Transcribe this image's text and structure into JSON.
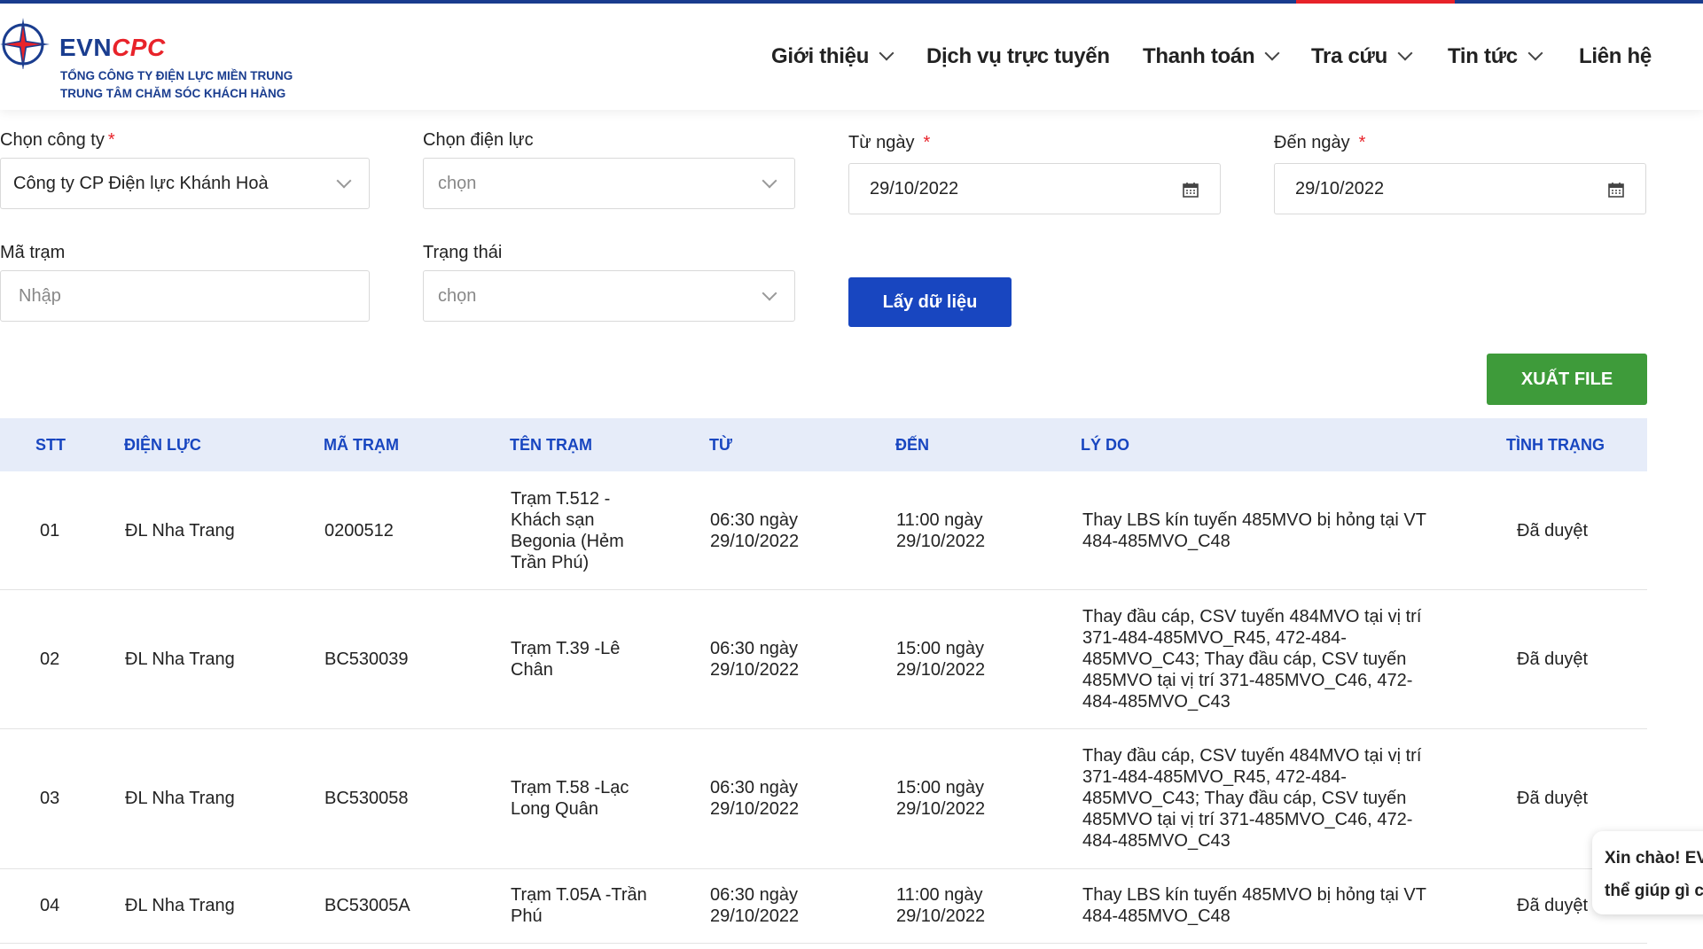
{
  "header": {
    "brand_evn": "EVN",
    "brand_cpc": "CPC",
    "subtitle_1": "TỔNG CÔNG TY ĐIỆN LỰC MIỀN TRUNG",
    "subtitle_2": "TRUNG TÂM CHĂM SÓC KHÁCH HÀNG",
    "nav": [
      {
        "label": "Giới thiệu"
      },
      {
        "label": "Dịch vụ trực tuyến"
      },
      {
        "label": "Thanh toán"
      },
      {
        "label": "Tra cứu"
      },
      {
        "label": "Tin tức"
      },
      {
        "label": "Liên hệ"
      }
    ]
  },
  "form": {
    "company_label": "Chọn công ty",
    "company_value": "Công ty CP Điện lực Khánh Hoà",
    "district_label": "Chọn điện lực",
    "district_placeholder": "chọn",
    "from_label": "Từ ngày",
    "from_value": "29/10/2022",
    "to_label": "Đến ngày",
    "to_value": "29/10/2022",
    "station_label": "Mã trạm",
    "station_placeholder": "Nhập",
    "status_label": "Trạng thái",
    "status_placeholder": "chọn",
    "required_mark": "*",
    "get_button": "Lấy dữ liệu",
    "export_button": "XUẤT FILE"
  },
  "table": {
    "headers": [
      "STT",
      "ĐIỆN LỰC",
      "MÃ TRẠM",
      "TÊN TRẠM",
      "TỪ",
      "ĐẾN",
      "LÝ DO",
      "TÌNH TRẠNG"
    ],
    "rows": [
      {
        "stt": "01",
        "dienluc": "ĐL Nha Trang",
        "matram": "0200512",
        "tentram": "Trạm T.512 - Khách sạn Begonia (Hẻm Trần Phú)",
        "tu": "06:30 ngày 29/10/2022",
        "den": "11:00 ngày 29/10/2022",
        "lydo": "Thay LBS kín tuyến 485MVO bị hỏng tại VT 484-485MVO_C48",
        "tinhtrang": "Đã duyệt"
      },
      {
        "stt": "02",
        "dienluc": "ĐL Nha Trang",
        "matram": "BC530039",
        "tentram": "Trạm T.39 -Lê Chân",
        "tu": "06:30 ngày 29/10/2022",
        "den": "15:00 ngày 29/10/2022",
        "lydo": "Thay đầu cáp, CSV tuyến 484MVO tại vị trí 371-484-485MVO_R45, 472-484-485MVO_C43; Thay đầu cáp, CSV tuyến 485MVO tại vị trí 371-485MVO_C46, 472-484-485MVO_C43",
        "tinhtrang": "Đã duyệt"
      },
      {
        "stt": "03",
        "dienluc": "ĐL Nha Trang",
        "matram": "BC530058",
        "tentram": "Trạm T.58 -Lạc Long Quân",
        "tu": "06:30 ngày 29/10/2022",
        "den": "15:00 ngày 29/10/2022",
        "lydo": "Thay đầu cáp, CSV tuyến 484MVO tại vị trí 371-484-485MVO_R45, 472-484-485MVO_C43; Thay đầu cáp, CSV tuyến 485MVO tại vị trí 371-485MVO_C46, 472-484-485MVO_C43",
        "tinhtrang": "Đã duyệt"
      },
      {
        "stt": "04",
        "dienluc": "ĐL Nha Trang",
        "matram": "BC53005A",
        "tentram": "Trạm T.05A -Trần Phú",
        "tu": "06:30 ngày 29/10/2022",
        "den": "11:00 ngày 29/10/2022",
        "lydo": "Thay LBS kín tuyến 485MVO bị hỏng tại VT 484-485MVO_C48",
        "tinhtrang": "Đã duyệt"
      }
    ]
  },
  "chat": {
    "line1": "Xin chào! EV",
    "line2": "thể giúp gì c"
  },
  "colors": {
    "brand_blue": "#1a3d8f",
    "brand_red": "#e8232a",
    "button_blue": "#1846c0",
    "export_green": "#3e9b3a",
    "table_header_bg": "#e6ecf9"
  },
  "icons": {
    "logo": "evn-star-logo-icon",
    "dropdown": "chevron-down-icon",
    "date": "calendar-icon"
  }
}
